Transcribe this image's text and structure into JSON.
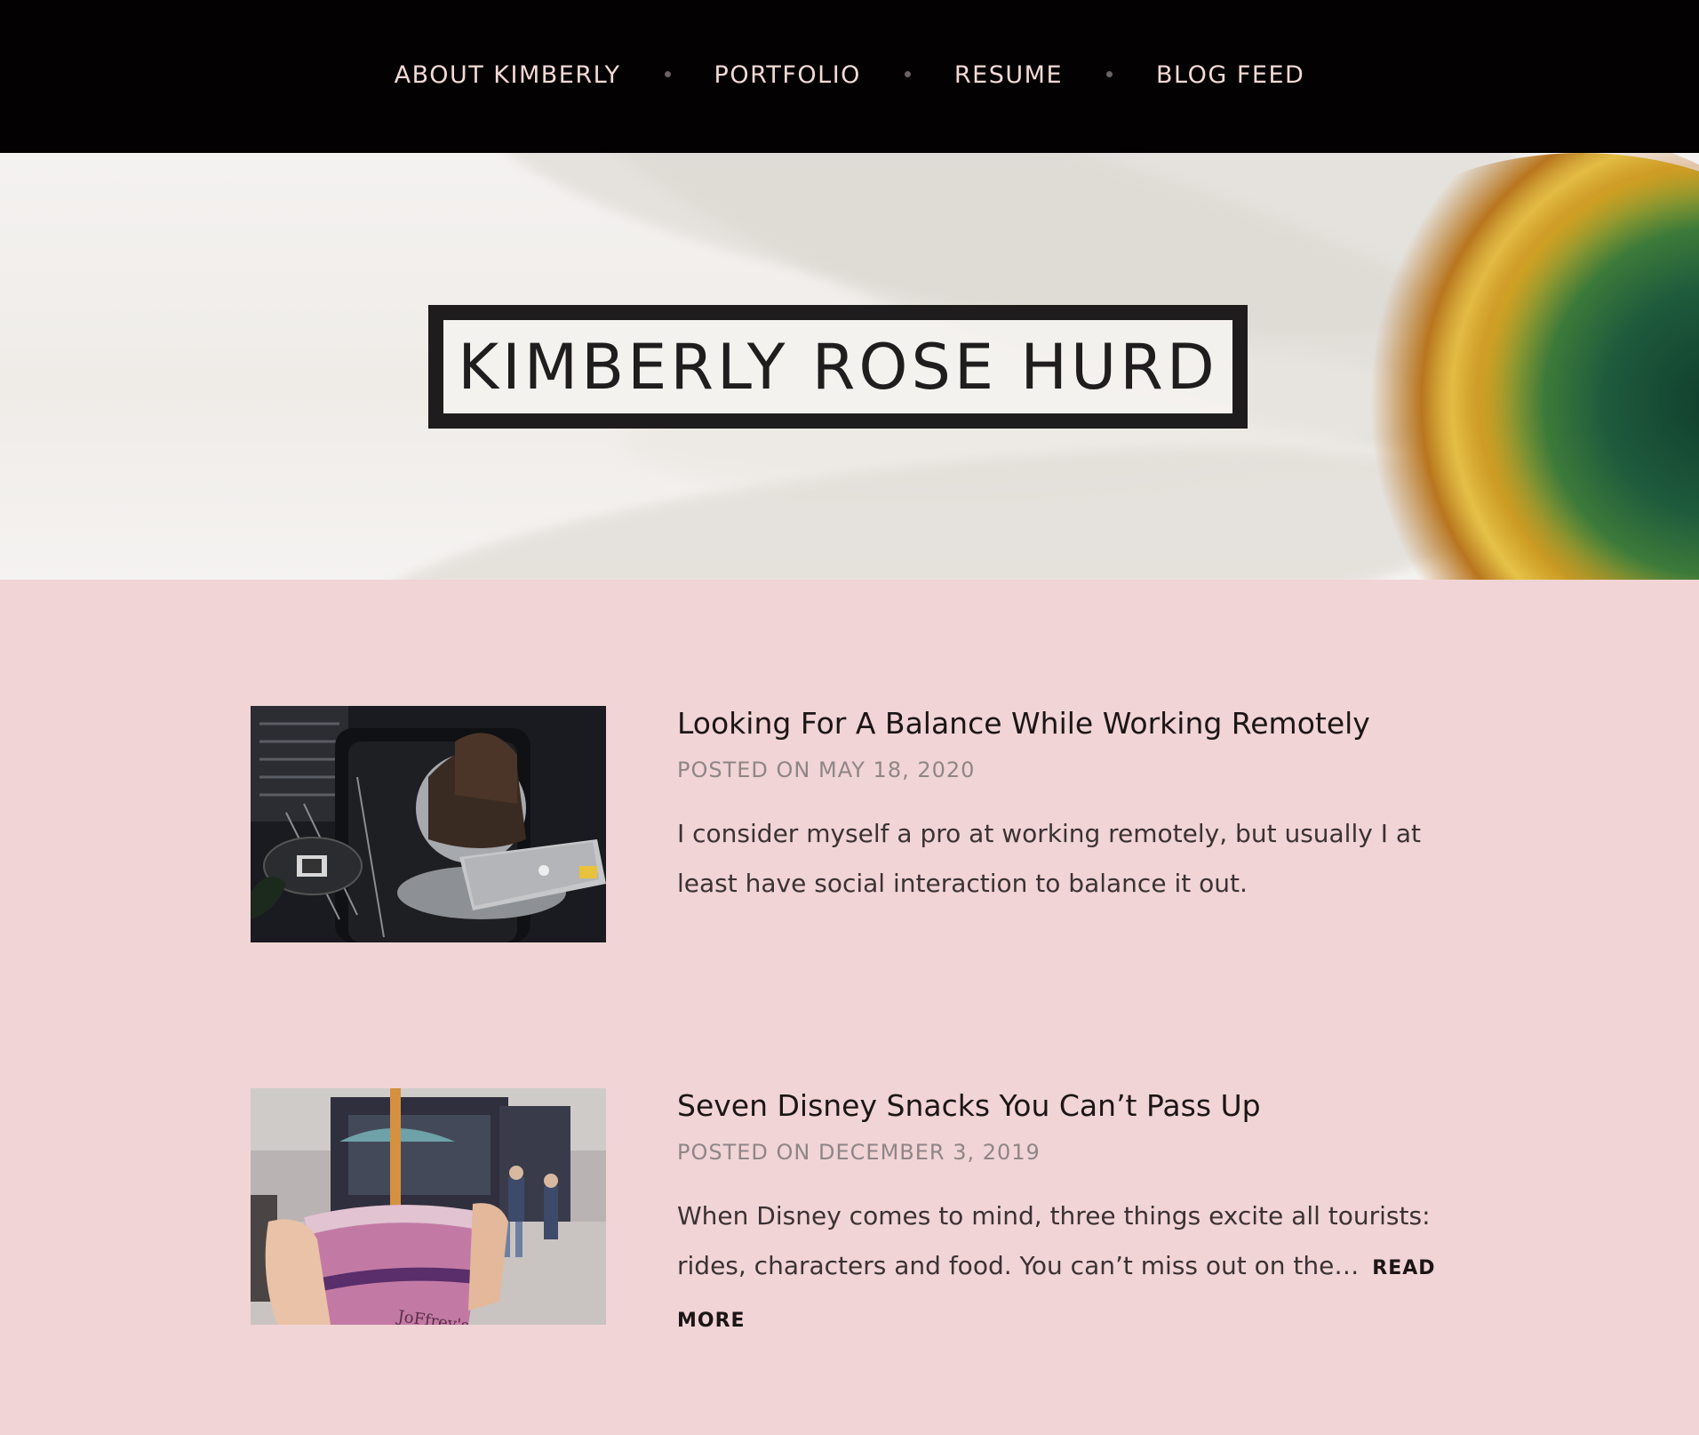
{
  "nav": {
    "items": [
      "ABOUT KIMBERLY",
      "PORTFOLIO",
      "RESUME",
      "BLOG FEED"
    ]
  },
  "hero": {
    "site_title": "KIMBERLY ROSE HURD"
  },
  "posts": [
    {
      "title": "Looking For A Balance While Working Remotely",
      "meta": "POSTED ON MAY 18, 2020",
      "excerpt": "I consider myself a pro at working remotely, but usually I at least have social interaction to balance it out.",
      "read_more": ""
    },
    {
      "title": "Seven Disney Snacks You Can’t Pass Up",
      "meta": "POSTED ON DECEMBER 3, 2019",
      "excerpt": "When Disney comes to mind, three things excite all tourists: rides, characters and food. You can’t miss out on the…",
      "read_more": "READ MORE"
    }
  ],
  "colors": {
    "nav_bg": "#030102",
    "nav_text": "#f3d9d6",
    "page_bg": "#f1d4d5",
    "title_border": "#1e1c1c"
  },
  "icons": [
    "nav-separator-dot"
  ]
}
